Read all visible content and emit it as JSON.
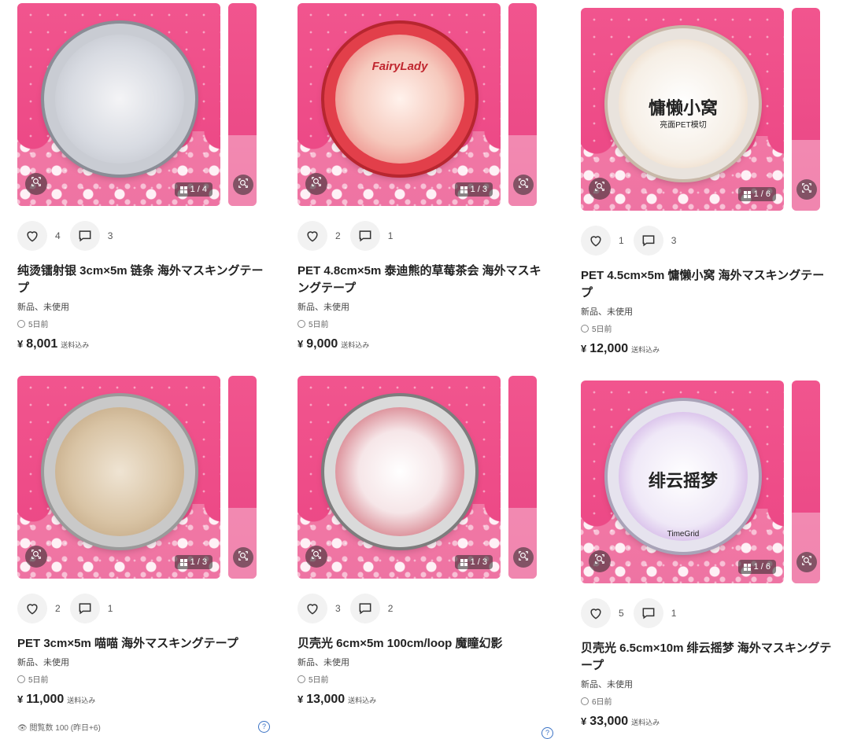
{
  "items": [
    {
      "title": "纯烫镭射银 3cm×5m 链条 海外マスキングテープ",
      "condition": "新品、未使用",
      "time": "5日前",
      "currency": "¥",
      "price": "8,001",
      "shipping": "送料込み",
      "likes": "4",
      "comments": "3",
      "image_counter": "1 / 4",
      "roll_theme": "silver-chain"
    },
    {
      "title": "PET 4.8cm×5m 泰迪熊的草莓茶会 海外マスキングテープ",
      "condition": "新品、未使用",
      "time": "5日前",
      "currency": "¥",
      "price": "9,000",
      "shipping": "送料込み",
      "likes": "2",
      "comments": "1",
      "image_counter": "1 / 3",
      "roll_label": "FairyLady",
      "roll_theme": "strawberry-bears"
    },
    {
      "title": "PET 4.5cm×5m 慵懒小窝 海外マスキングテープ",
      "condition": "新品、未使用",
      "time": "5日前",
      "currency": "¥",
      "price": "12,000",
      "shipping": "送料込み",
      "likes": "1",
      "comments": "3",
      "image_counter": "1 / 6",
      "roll_label": "慵懒小窝",
      "roll_sublabel": "亮面PET模切",
      "roll_theme": "cozy-room"
    },
    {
      "title": "PET 3cm×5m 喵喵 海外マスキングテープ",
      "condition": "新品、未使用",
      "time": "5日前",
      "currency": "¥",
      "price": "11,000",
      "shipping": "送料込み",
      "likes": "2",
      "comments": "1",
      "image_counter": "1 / 3",
      "roll_theme": "cat-sepia"
    },
    {
      "title": "贝壳光 6cm×5m 100cm/loop 魔瞳幻影",
      "condition": "新品、未使用",
      "time": "5日前",
      "currency": "¥",
      "price": "13,000",
      "shipping": "送料込み",
      "likes": "3",
      "comments": "2",
      "image_counter": "1 / 3",
      "roll_theme": "red-eye-monster"
    },
    {
      "title": "贝壳光 6.5cm×10m 绯云摇梦 海外マスキングテープ",
      "condition": "新品、未使用",
      "time": "6日前",
      "currency": "¥",
      "price": "33,000",
      "shipping": "送料込み",
      "likes": "5",
      "comments": "1",
      "image_counter": "1 / 6",
      "roll_label": "绯云摇梦",
      "roll_sublabel": "TimeGrid",
      "roll_theme": "purple-anemone"
    }
  ],
  "footer": {
    "views": "閲覧数 100 (昨日+6)"
  },
  "colors": {
    "background_pink": "#ee4c88",
    "button_grey": "#f2f2f2",
    "help_blue": "#3b73c5"
  }
}
